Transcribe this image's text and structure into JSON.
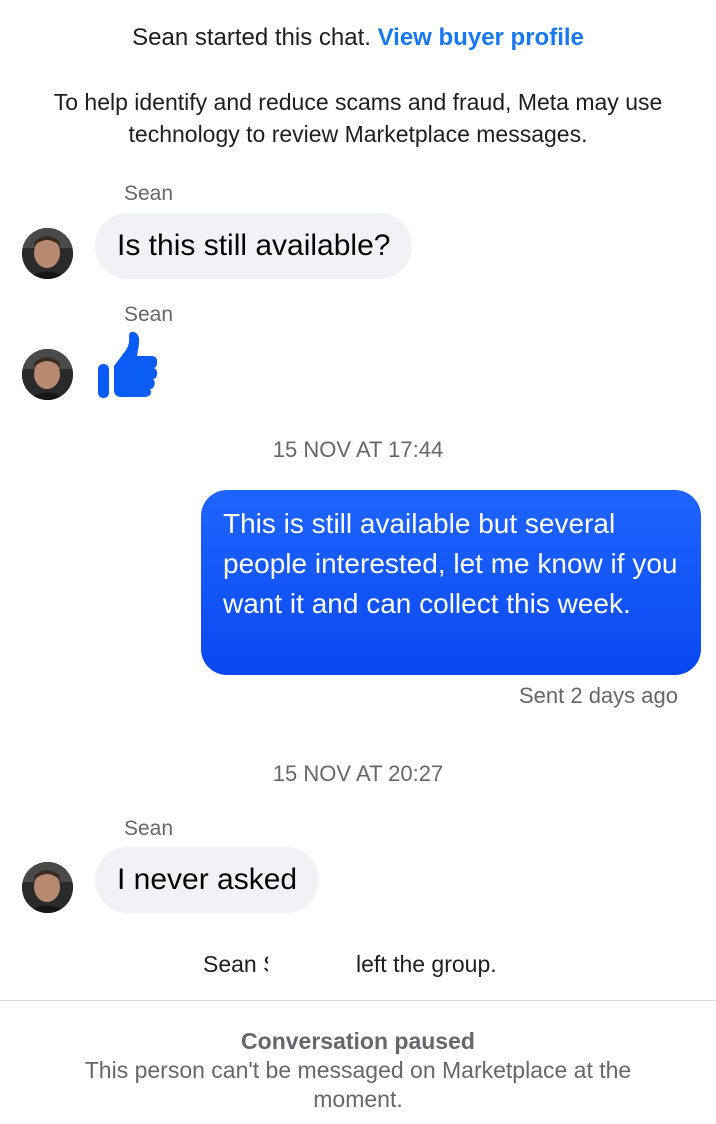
{
  "header": {
    "started_text": "Sean started this chat.",
    "profile_link": "View buyer profile"
  },
  "notice": "To help identify and reduce scams and fraud, Meta may use technology to review Marketplace messages.",
  "messages": [
    {
      "sender": "Sean",
      "text": "Is this still available?"
    },
    {
      "sender": "Sean",
      "reaction": "thumbs-up-icon"
    },
    {
      "timestamp": "15 NOV AT 17:44"
    },
    {
      "from_me": true,
      "text": "This is still available but several people interested, let me know if you want it and can collect this week.",
      "status": "Sent 2 days ago"
    },
    {
      "timestamp": "15 NOV AT 20:27"
    },
    {
      "sender": "Sean",
      "text": "I never asked"
    }
  ],
  "system": {
    "left_name": "Sean S",
    "left_suffix": "left the group."
  },
  "footer": {
    "title": "Conversation paused",
    "text": "This person can't be messaged on Marketplace at the moment."
  },
  "colors": {
    "link": "#1877f2",
    "outgoing_bubble": "#1f64ff",
    "incoming_bubble": "#f0f2f5",
    "thumb": "#0a5cf5"
  }
}
